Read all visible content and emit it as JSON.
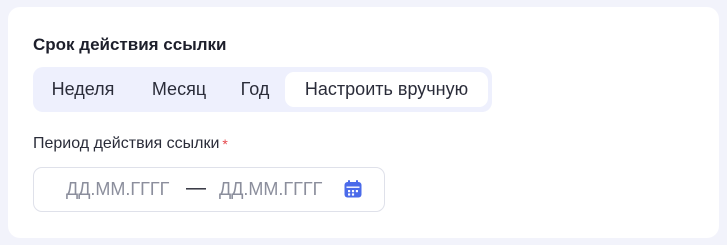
{
  "link_validity": {
    "title": "Срок действия ссылки",
    "options": [
      {
        "label": "Неделя",
        "selected": false
      },
      {
        "label": "Месяц",
        "selected": false
      },
      {
        "label": "Год",
        "selected": false
      },
      {
        "label": "Настроить вручную",
        "selected": true
      }
    ]
  },
  "period": {
    "label": "Период действия ссылки",
    "required_mark": "*",
    "from_placeholder": "ДД.ММ.ГГГГ",
    "separator": "—",
    "to_placeholder": "ДД.ММ.ГГГГ",
    "icon": "calendar-icon"
  },
  "colors": {
    "accent": "#4b6bea",
    "segmented_bg": "#eef0fd",
    "required": "#e5484d"
  }
}
